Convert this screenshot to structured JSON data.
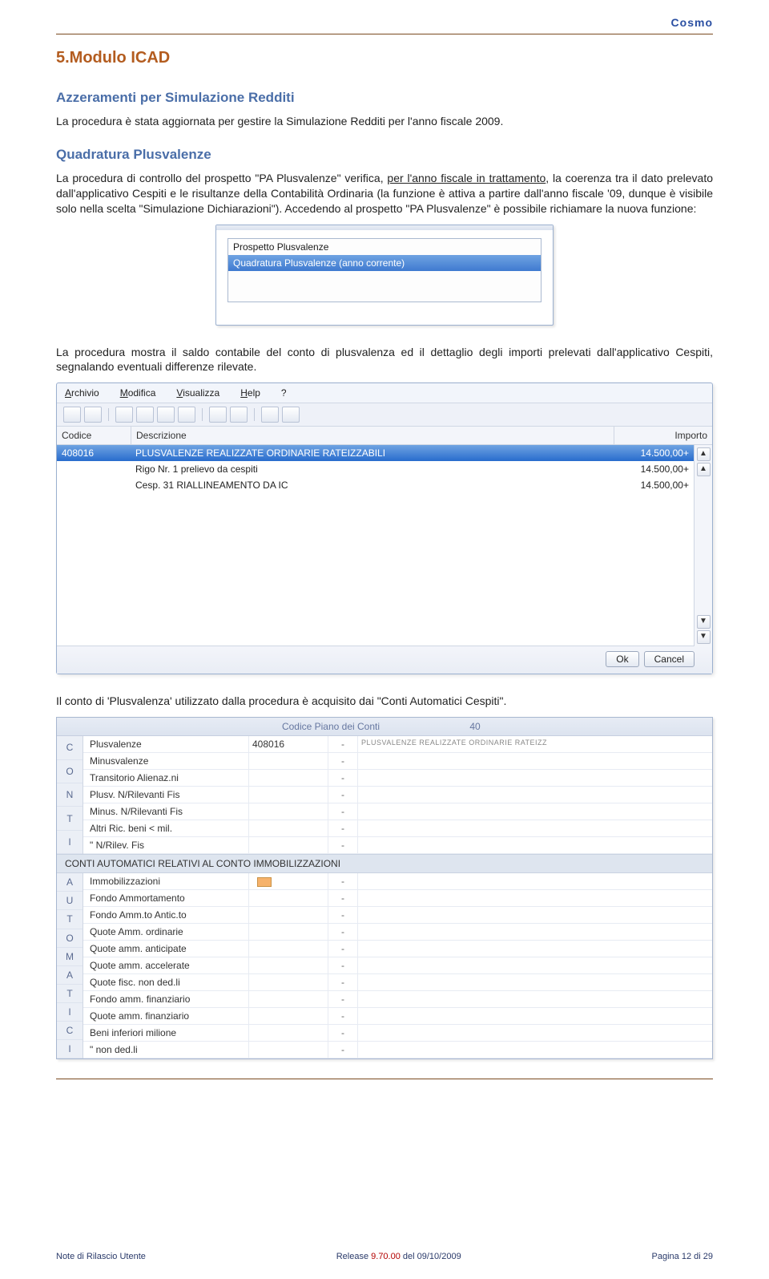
{
  "header": {
    "brand": "Cosmo"
  },
  "section": {
    "title": "5.Modulo ICAD"
  },
  "s1": {
    "title": "Azzeramenti per Simulazione Redditi",
    "body": "La procedura è stata aggiornata per gestire la Simulazione Redditi per l'anno fiscale 2009."
  },
  "s2": {
    "title": "Quadratura Plusvalenze",
    "b1a": "La procedura di controllo del prospetto \"PA Plusvalenze\" verifica, ",
    "b1u": "per l'anno fiscale in trattamento",
    "b1b": ", la coerenza tra il dato prelevato dall'applicativo Cespiti e le risultanze della Contabilità Ordinaria (la funzione è attiva a partire dall'anno fiscale '09, dunque è visibile solo nella scelta \"Simulazione Dichiarazioni\"). Accedendo al prospetto \"PA Plusvalenze\" è possibile richiamare la nuova funzione:"
  },
  "fig1": {
    "row1": "Prospetto Plusvalenze",
    "row2": "Quadratura Plusvalenze (anno corrente)"
  },
  "p3": "La procedura mostra il saldo contabile del conto di plusvalenza ed il dettaglio degli importi prelevati dall'applicativo Cespiti, segnalando eventuali differenze rilevate.",
  "fig2": {
    "menu": {
      "m1": "Archivio",
      "m2": "Modifica",
      "m3": "Visualizza",
      "m4": "Help",
      "m5": "?"
    },
    "hdr": {
      "c1": "Codice",
      "c2": "Descrizione",
      "c3": "Importo"
    },
    "rows": [
      {
        "c1": "408016",
        "c2": "PLUSVALENZE REALIZZATE ORDINARIE RATEIZZABILI",
        "c3": "14.500,00+"
      },
      {
        "c1": "",
        "c2": "Rigo Nr.   1 prelievo da cespiti",
        "c3": "14.500,00+"
      },
      {
        "c1": "",
        "c2": "Cesp.   31  RIALLINEAMENTO DA IC",
        "c3": "14.500,00+"
      }
    ],
    "btns": {
      "ok": "Ok",
      "cancel": "Cancel"
    }
  },
  "p4": "Il conto di 'Plusvalenza' utilizzato dalla procedura è acquisito dai \"Conti Automatici Cespiti\".",
  "fig3": {
    "caphdr": {
      "lab": "Codice Piano dei Conti",
      "val": "40"
    },
    "lettersA": [
      "C",
      "O",
      "N",
      "T",
      "I"
    ],
    "lettersB": [
      "A",
      "U",
      "T",
      "O",
      "M",
      "A",
      "T",
      "I",
      "C",
      "I"
    ],
    "blockA": [
      {
        "nm": "Plusvalenze",
        "code": "408016",
        "dash": "-",
        "desc": "PLUSVALENZE REALIZZATE ORDINARIE RATEIZZ"
      },
      {
        "nm": "Minusvalenze",
        "code": "",
        "dash": "-",
        "desc": ""
      },
      {
        "nm": "Transitorio Alienaz.ni",
        "code": "",
        "dash": "-",
        "desc": ""
      },
      {
        "nm": "Plusv. N/Rilevanti Fis",
        "code": "",
        "dash": "-",
        "desc": ""
      },
      {
        "nm": "Minus. N/Rilevanti Fis",
        "code": "",
        "dash": "-",
        "desc": ""
      },
      {
        "nm": "Altri Ric. beni < mil.",
        "code": "",
        "dash": "-",
        "desc": ""
      },
      {
        "nm": "    \"        N/Rilev. Fis",
        "code": "",
        "dash": "-",
        "desc": ""
      }
    ],
    "sechdr": "CONTI AUTOMATICI RELATIVI AL CONTO IMMOBILIZZAZIONI",
    "blockB": [
      {
        "nm": "Immobilizzazioni",
        "code": "",
        "dash": "-",
        "desc": "",
        "swatch": true
      },
      {
        "nm": "Fondo Ammortamento",
        "code": "",
        "dash": "-",
        "desc": ""
      },
      {
        "nm": "Fondo Amm.to Antic.to",
        "code": "",
        "dash": "-",
        "desc": ""
      },
      {
        "nm": "Quote Amm. ordinarie",
        "code": "",
        "dash": "-",
        "desc": ""
      },
      {
        "nm": "Quote amm. anticipate",
        "code": "",
        "dash": "-",
        "desc": ""
      },
      {
        "nm": "Quote amm. accelerate",
        "code": "",
        "dash": "-",
        "desc": ""
      },
      {
        "nm": "Quote fisc. non ded.li",
        "code": "",
        "dash": "-",
        "desc": ""
      },
      {
        "nm": "Fondo amm. finanziario",
        "code": "",
        "dash": "-",
        "desc": ""
      },
      {
        "nm": "Quote amm. finanziario",
        "code": "",
        "dash": "-",
        "desc": ""
      },
      {
        "nm": "Beni inferiori milione",
        "code": "",
        "dash": "-",
        "desc": ""
      },
      {
        "nm": "    \"        non ded.li",
        "code": "",
        "dash": "-",
        "desc": ""
      }
    ]
  },
  "footer": {
    "left": "Note di Rilascio Utente",
    "mid_a": "Release ",
    "mid_b": "9.70.00",
    "mid_c": " del 09/10/2009",
    "right": "Pagina 12 di 29"
  }
}
